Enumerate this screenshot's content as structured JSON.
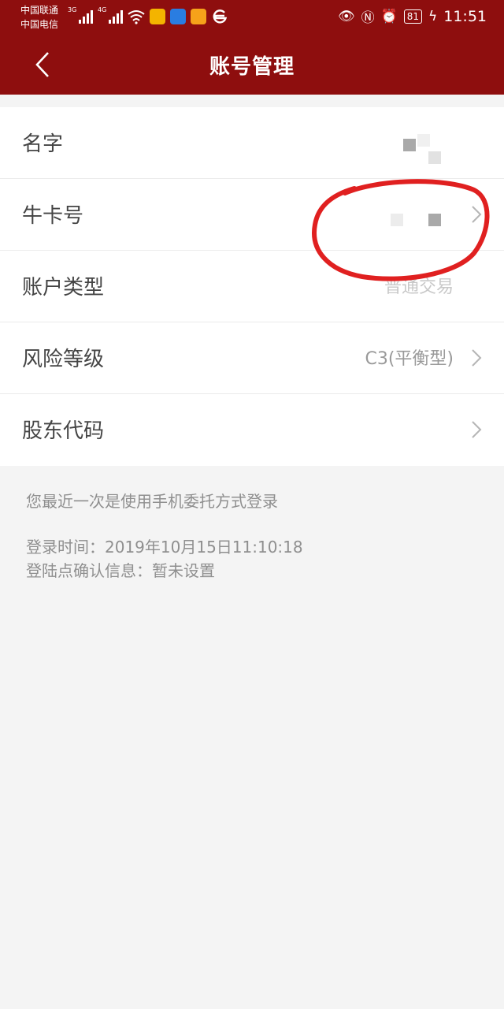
{
  "status_bar": {
    "carrier_1": "中国联通",
    "carrier_2": "中国电信",
    "network_1": "3G",
    "network_2": "4G",
    "battery": "81",
    "time": "11:51"
  },
  "header": {
    "title": "账号管理",
    "accent_color": "#8e0e0e"
  },
  "rows": [
    {
      "label": "名字",
      "value": ""
    },
    {
      "label": "牛卡号",
      "value": ""
    },
    {
      "label": "账户类型",
      "value": "普通交易"
    },
    {
      "label": "风险等级",
      "value": "C3(平衡型)"
    },
    {
      "label": "股东代码",
      "value": ""
    }
  ],
  "info": {
    "login_method": "您最近一次是使用手机委托方式登录",
    "login_time": "登录时间：2019年10月15日11:10:18",
    "confirm_info": "登陆点确认信息：暂未设置"
  }
}
